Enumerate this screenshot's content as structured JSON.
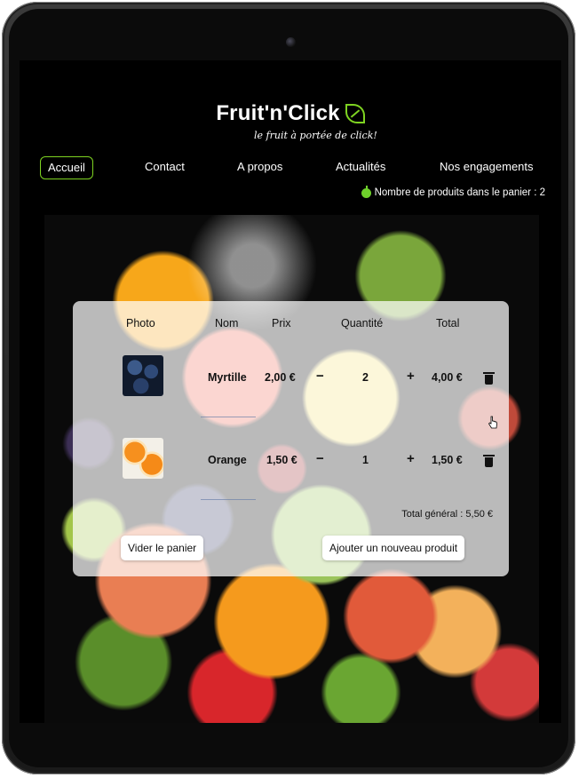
{
  "app": {
    "logo_title": "Fruit'n'Click",
    "slogan": "le fruit à portée de click!"
  },
  "nav": {
    "items": [
      "Accueil",
      "Contact",
      "A propos",
      "Actualités",
      "Nos engagements"
    ],
    "active": "Accueil"
  },
  "cart_status": {
    "text": "Nombre de produits dans le panier : 2"
  },
  "cart": {
    "headers": {
      "photo": "Photo",
      "name": "Nom",
      "price": "Prix",
      "quantity": "Quantité",
      "total": "Total"
    },
    "rows": [
      {
        "name": "Myrtille",
        "price": "2,00 €",
        "quantity": "2",
        "total": "4,00 €",
        "image": "blueberries"
      },
      {
        "name": "Orange",
        "price": "1,50 €",
        "quantity": "1",
        "total": "1,50 €",
        "image": "orange-slices"
      }
    ],
    "minus_symbol": "−",
    "plus_symbol": "+",
    "grand_total": "Total général : 5,50 €",
    "empty_button": "Vider le panier",
    "add_button": "Ajouter un nouveau produit"
  },
  "colors": {
    "accent": "#7ed321",
    "background": "#000000",
    "cart_panel": "rgba(255,255,255,0.72)"
  },
  "icons": [
    "leaf-icon",
    "apple-icon",
    "trash-icon",
    "pointer-cursor-icon",
    "camera-icon"
  ]
}
